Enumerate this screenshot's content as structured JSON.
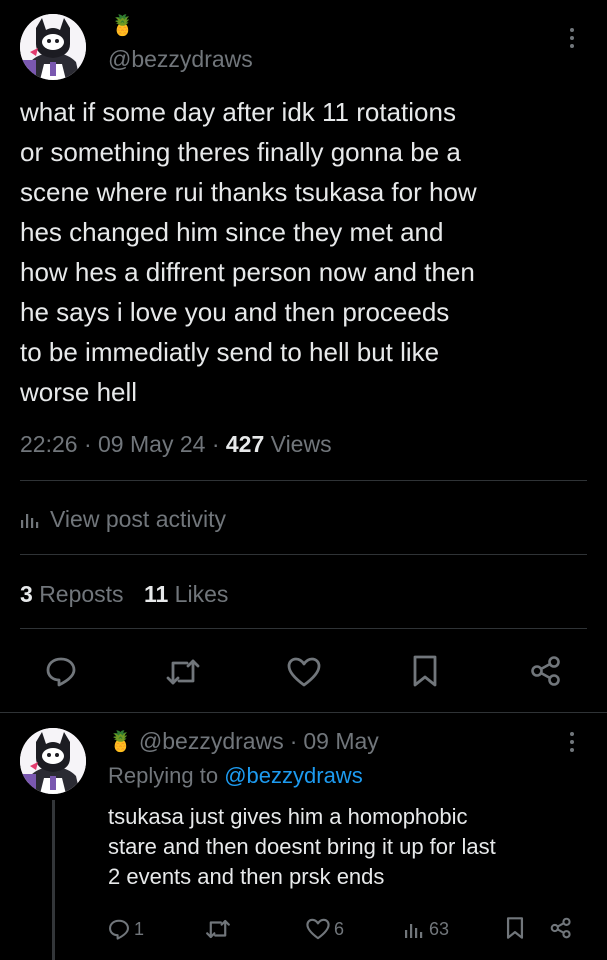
{
  "post": {
    "emoji": "🍍",
    "handle": "@bezzydraws",
    "text": "what if some day after idk 11 rotations\nor something theres finally gonna be a\nscene where rui thanks tsukasa for how\nhes changed him since they met and\nhow hes a diffrent person now and then\nhe says i love you and then proceeds\nto be immediatly send to hell but like\nworse hell",
    "time": "22:26",
    "date": "09 May 24",
    "sep": "·",
    "views_count": "427",
    "views_label": "Views",
    "activity_label": "View post activity",
    "reposts_count": "3",
    "reposts_label": "Reposts",
    "likes_count": "11",
    "likes_label": "Likes"
  },
  "action_icons": [
    "reply-icon",
    "repost-icon",
    "like-icon",
    "bookmark-icon",
    "share-icon"
  ],
  "reply": {
    "emoji": "🍍",
    "handle": "@bezzydraws",
    "sep": "·",
    "date": "09 May",
    "replying_prefix": "Replying to",
    "replying_handle": "@bezzydraws",
    "text": "tsukasa just gives him a homophobic\nstare and then doesnt bring it up for last\n2 events and then prsk ends",
    "reply_count": "1",
    "like_count": "6",
    "view_count": "63"
  },
  "colors": {
    "background": "#000000",
    "text": "#e7e9ea",
    "muted": "#71767b",
    "link": "#1d9bf0",
    "divider": "#2f3336"
  }
}
